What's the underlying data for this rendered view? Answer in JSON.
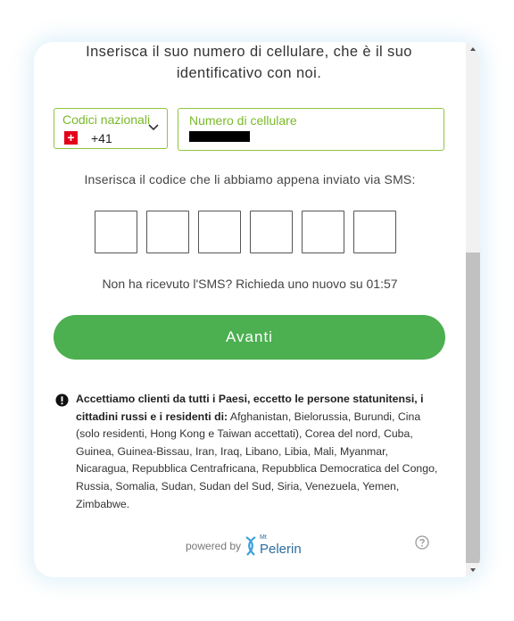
{
  "intro": {
    "line1": "Inserisca il suo numero di cellulare, che è il suo",
    "line2": "identificativo con noi."
  },
  "country": {
    "label": "Codici nazionali",
    "code": "+41",
    "flag_icon": "swiss-flag-icon"
  },
  "phone": {
    "label": "Numero di cellulare",
    "value": "redacted"
  },
  "sms": {
    "prompt": "Inserisca il codice che li abbiamo appena inviato via SMS:",
    "digits": [
      "",
      "",
      "",
      "",
      "",
      ""
    ]
  },
  "resend": {
    "text": "Non ha ricevuto l'SMS? Richieda uno nuovo su 01:57"
  },
  "submit_label": "Avanti",
  "notice": {
    "bold": "Accettiamo clienti da tutti i Paesi, eccetto le persone statunitensi, i cittadini russi e i residenti di:",
    "rest": " Afghanistan, Bielorussia, Burundi, Cina (solo residenti, Hong Kong e Taiwan accettati), Corea del nord, Cuba, Guinea, Guinea-Bissau, Iran, Iraq, Libano, Libia, Mali, Myanmar, Nicaragua, Repubblica Centrafricana, Repubblica Democratica del Congo, Russia, Somalia, Sudan, Sudan del Sud, Siria, Venezuela, Yemen, Zimbabwe."
  },
  "footer": {
    "powered_by": "powered by",
    "brand_small": "Mt",
    "brand": "Pelerin"
  },
  "colors": {
    "accent_green": "#4caf50",
    "field_border": "#8dc63f",
    "field_label": "#7ab929",
    "brand_blue": "#2d6c9c"
  }
}
